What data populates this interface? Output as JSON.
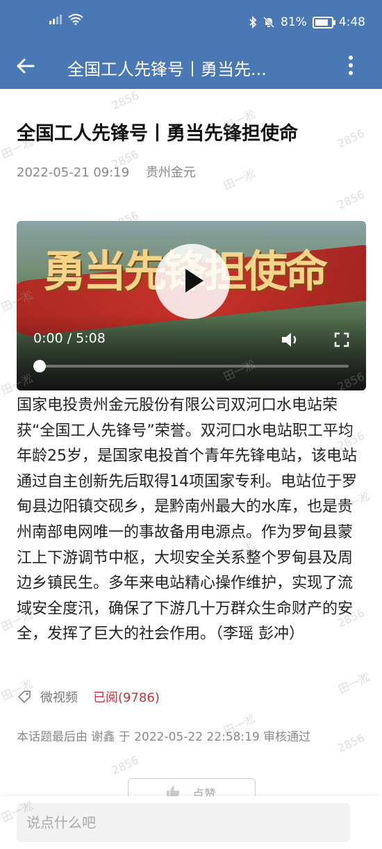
{
  "status_bar": {
    "signal_text": "ᵢₗₗ",
    "battery_percent": "81%",
    "battery_level": 0.81,
    "time": "4:48"
  },
  "app_bar": {
    "title": "全国工人先锋号丨勇当先..."
  },
  "article": {
    "title": "全国工人先锋号丨勇当先锋担使命",
    "date": "2022-05-21 09:19",
    "source": "贵州金元",
    "video": {
      "overlay_text": "勇当先锋担使命",
      "time": "0:00 / 5:08",
      "progress": 0.0
    },
    "body": "国家电投贵州金元股份有限公司双河口水电站荣获“全国工人先锋号”荣誉。双河口水电站职工平均年龄25岁，是国家电投首个青年先锋电站，该电站通过自主创新先后取得14项国家专利。电站位于罗甸县边阳镇交砚乡，是黔南州最大的水库，也是贵州南部电网唯一的事故备用电源点。作为罗甸县蒙江上下游调节中枢，大坝安全关系整个罗甸县及周边乡镇民生。多年来电站精心操作维护，实现了流域安全度汛，确保了下游几十万群众生命财产的安全，发挥了巨大的社会作用。（李瑶 彭冲）",
    "tag": "微视频",
    "read_count": "已阅(9786)",
    "audit": "本话题最后由 谢鑫 于 2022-05-22 22:58:19 审核通过",
    "like_label": "点赞"
  },
  "comment": {
    "placeholder": "说点什么吧"
  },
  "watermark": {
    "code": "2856",
    "name": "田一淞"
  },
  "colors": {
    "header": "#4a78b4",
    "accent_red": "#c8313a"
  }
}
